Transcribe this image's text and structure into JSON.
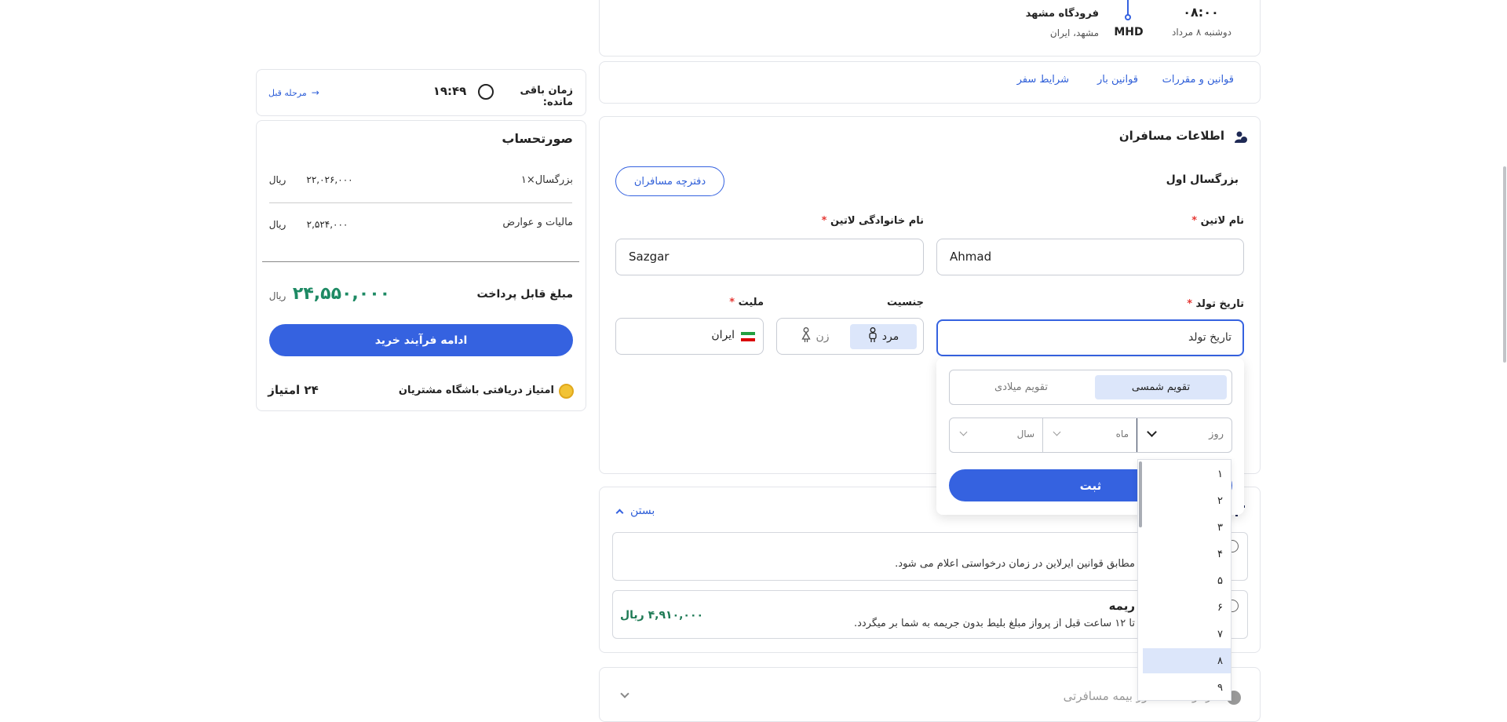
{
  "flight": {
    "time": "۰۸:۰۰",
    "date": "دوشنبه ۸ مرداد",
    "code": "MHD",
    "airport": "فرودگاه مشهد",
    "city": "مشهد، ایران"
  },
  "links": {
    "rules": "قوانین و مقررات",
    "baggage": "قوانین بار",
    "conditions": "شرایط سفر"
  },
  "passengers": {
    "section_title": "اطلاعات مسافران",
    "passenger_title": "بزرگسال اول",
    "notebook_button": "دفترچه مسافران",
    "first_name_label": "نام لاتین",
    "first_name_value": "Ahmad",
    "last_name_label": "نام خانوادگی لاتین",
    "last_name_value": "Sazgar",
    "birth_label": "تاریخ تولد",
    "birth_placeholder": "تاریخ تولد",
    "gender_label": "جنسیت",
    "gender_male": "مرد",
    "gender_female": "زن",
    "nationality_label": "ملیت",
    "nationality_value": "ایران",
    "required_mark": "*"
  },
  "datepicker": {
    "tab_shamsi": "تقویم شمسی",
    "tab_miladi": "تقویم میلادی",
    "day_label": "روز",
    "month_label": "ماه",
    "year_label": "سال",
    "submit": "ثبت",
    "day_options": [
      "۱",
      "۲",
      "۳",
      "۴",
      "۵",
      "۶",
      "۷",
      "۸",
      "۹"
    ],
    "selected_day": "۸"
  },
  "refund": {
    "close_label": "بستن",
    "option1_text": "مطابق قوانین ایرلاین در زمان درخواستی اعلام می شود.",
    "option2_title": "ریمه",
    "option2_text": "تا ۱۲ ساعت قبل از پرواز مبلغ بلیط بدون جریمه به شما بر میگردد.",
    "option2_price": "۴,۹۱۰,۰۰۰ ریال",
    "insurance_label": "درخواست صدور بیمه مسافرتی"
  },
  "timer": {
    "label": "زمان باقی مانده:",
    "value": "۱۹:۴۹",
    "back": "مرحله قبل"
  },
  "invoice": {
    "title": "صورتحساب",
    "adult_label": "بزرگسال×۱",
    "adult_value": "۲۲,۰۲۶,۰۰۰",
    "tax_label": "مالیات و عوارض",
    "tax_value": "۲,۵۲۴,۰۰۰",
    "currency": "ریال",
    "total_label": "مبلغ قابل پرداخت",
    "total_value": "۲۴,۵۵۰,۰۰۰",
    "continue_button": "ادامه فرآیند خرید",
    "club_label": "امتیاز دریافتی باشگاه مشتریان",
    "club_value": "۲۴ امتیاز"
  }
}
